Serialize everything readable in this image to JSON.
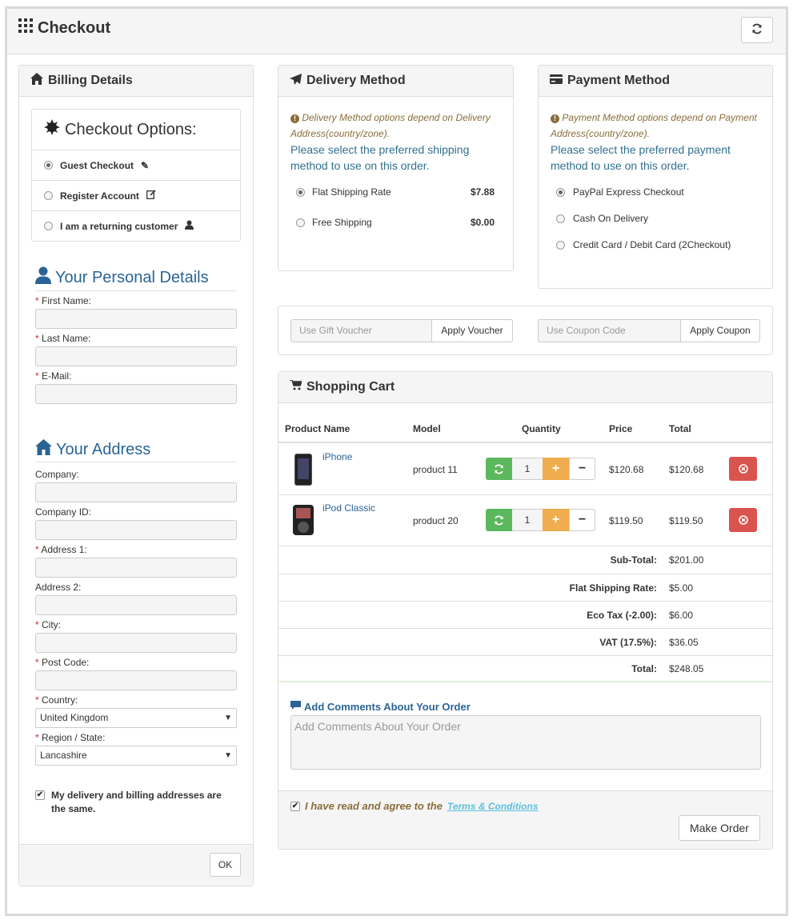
{
  "header": {
    "title": "Checkout"
  },
  "billing": {
    "panel_title": "Billing Details",
    "checkout_options_title": "Checkout Options:",
    "options": [
      {
        "label": "Guest Checkout",
        "selected": true
      },
      {
        "label": "Register Account",
        "selected": false
      },
      {
        "label": "I am a returning customer",
        "selected": false
      }
    ],
    "personal_title": "Your Personal Details",
    "first_name_label": "First Name:",
    "last_name_label": "Last Name:",
    "email_label": "E-Mail:",
    "address_title": "Your Address",
    "company_label": "Company:",
    "company_id_label": "Company ID:",
    "address1_label": "Address 1:",
    "address2_label": "Address 2:",
    "city_label": "City:",
    "postcode_label": "Post Code:",
    "country_label": "Country:",
    "country_value": "United Kingdom",
    "region_label": "Region / State:",
    "region_value": "Lancashire",
    "same_address_label": "My delivery and billing addresses are the same.",
    "ok_label": "OK",
    "required_mark": "*"
  },
  "delivery": {
    "panel_title": "Delivery Method",
    "note": "Delivery Method options depend on Delivery Address(country/zone).",
    "help": "Please select the preferred shipping method to use on this order.",
    "methods": [
      {
        "label": "Flat Shipping Rate",
        "price": "$7.88",
        "selected": true
      },
      {
        "label": "Free Shipping",
        "price": "$0.00",
        "selected": false
      }
    ]
  },
  "payment": {
    "panel_title": "Payment Method",
    "note": "Payment Method options depend on Payment Address(country/zone).",
    "help": "Please select the preferred payment method to use on this order.",
    "methods": [
      {
        "label": "PayPal Express Checkout",
        "selected": true
      },
      {
        "label": "Cash On Delivery",
        "selected": false
      },
      {
        "label": "Credit Card / Debit Card (2Checkout)",
        "selected": false
      }
    ]
  },
  "voucher": {
    "placeholder": "Use Gift Voucher",
    "button": "Apply Voucher"
  },
  "coupon": {
    "placeholder": "Use Coupon Code",
    "button": "Apply Coupon"
  },
  "cart": {
    "panel_title": "Shopping Cart",
    "headers": [
      "Product Name",
      "Model",
      "Quantity",
      "Price",
      "Total"
    ],
    "items": [
      {
        "name": "iPhone",
        "model": "product 11",
        "qty": "1",
        "price": "$120.68",
        "total": "$120.68"
      },
      {
        "name": "iPod Classic",
        "model": "product 20",
        "qty": "1",
        "price": "$119.50",
        "total": "$119.50"
      }
    ],
    "totals": [
      {
        "label": "Sub-Total:",
        "value": "$201.00"
      },
      {
        "label": "Flat Shipping Rate:",
        "value": "$5.00"
      },
      {
        "label": "Eco Tax (-2.00):",
        "value": "$6.00"
      },
      {
        "label": "VAT (17.5%):",
        "value": "$36.05"
      },
      {
        "label": "Total:",
        "value": "$248.05"
      }
    ],
    "comments_title": "Add Comments About Your Order",
    "comments_placeholder": "Add Comments About Your Order",
    "agree_text": "I have read and agree to the",
    "terms_link": "Terms & Conditions",
    "make_order": "Make Order"
  },
  "colors": {
    "green": "#5cb85c",
    "orange": "#f0ad4e",
    "red": "#d9534f",
    "link": "#2a6496"
  }
}
